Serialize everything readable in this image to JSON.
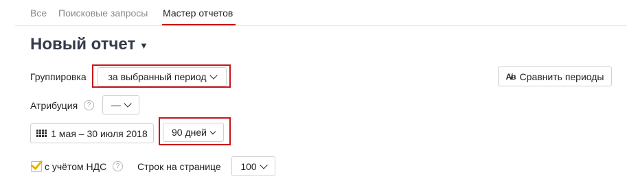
{
  "tabs": [
    {
      "label": "Все",
      "active": false
    },
    {
      "label": "Поисковые запросы",
      "active": false
    },
    {
      "label": "Мастер отчетов",
      "active": true
    }
  ],
  "title": "Новый отчет",
  "grouping": {
    "label": "Группировка",
    "value": "за выбранный период"
  },
  "compare_button": {
    "label": "Сравнить периоды",
    "icon": "compare-periods-icon"
  },
  "attribution": {
    "label": "Атрибуция",
    "value": "—"
  },
  "date_range": {
    "value": "1 мая – 30 июля 2018",
    "icon": "calendar-icon"
  },
  "period": {
    "value": "90 дней"
  },
  "vat": {
    "label": "с учётом НДС",
    "checked": true
  },
  "rows_per_page": {
    "label": "Строк на странице",
    "value": "100"
  },
  "colors": {
    "accent": "#cc0000",
    "highlight_box": "#c8141b",
    "title": "#333a4d",
    "checkmark": "#e8b200"
  }
}
